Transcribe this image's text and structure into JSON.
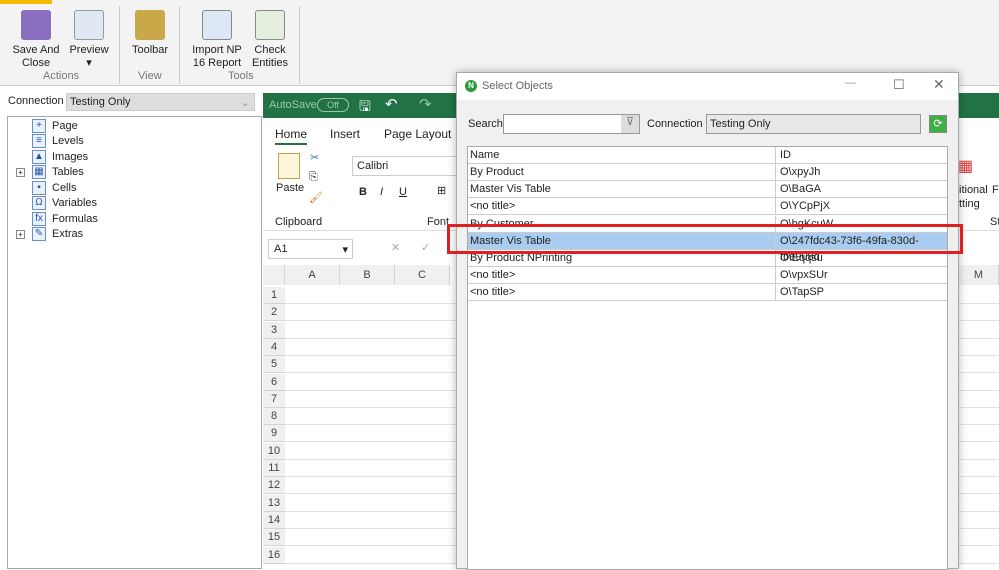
{
  "ribbon": {
    "buttons": [
      {
        "label": "Save And\nClose",
        "icon": "save-close-icon"
      },
      {
        "label": "Preview",
        "icon": "preview-icon"
      },
      {
        "label": "Toolbar",
        "icon": "tools-icon"
      },
      {
        "label": "Import NP\n16 Report",
        "icon": "import-icon"
      },
      {
        "label": "Check\nEntities",
        "icon": "check-entities-icon"
      }
    ],
    "groups": [
      "Actions",
      "View",
      "Tools"
    ]
  },
  "connection": {
    "label": "Connection",
    "value": "Testing Only"
  },
  "tree": [
    {
      "label": "Page",
      "expand": false,
      "glyph": "+"
    },
    {
      "label": "Levels",
      "expand": false,
      "glyph": "≡"
    },
    {
      "label": "Images",
      "expand": false,
      "glyph": "▲"
    },
    {
      "label": "Tables",
      "expand": true,
      "glyph": "▦"
    },
    {
      "label": "Cells",
      "expand": false,
      "glyph": "▪"
    },
    {
      "label": "Variables",
      "expand": false,
      "glyph": "Ω"
    },
    {
      "label": "Formulas",
      "expand": false,
      "glyph": "fx"
    },
    {
      "label": "Extras",
      "expand": true,
      "glyph": "✎"
    }
  ],
  "excel": {
    "autosave": "AutoSave",
    "autosave_state": "Off",
    "tabs": [
      "Home",
      "Insert",
      "Page Layout"
    ],
    "paste": "Paste",
    "font": "Calibri",
    "clipboard": "Clipboard",
    "font_group": "Font",
    "namebox": "A1",
    "columns": [
      "A",
      "B",
      "C"
    ],
    "rows": [
      "1",
      "2",
      "3",
      "4",
      "5",
      "6",
      "7",
      "8",
      "9",
      "10",
      "11",
      "12",
      "13",
      "14",
      "15",
      "16"
    ],
    "right_partial": {
      "cond1": "itional",
      "cond2": "tting",
      "f": "F",
      "st": "St",
      "col_m": "M"
    },
    "accent": "#217346"
  },
  "dialog": {
    "title": "Select Objects",
    "search_label": "Search",
    "search_value": "",
    "connection_label": "Connection",
    "connection_value": "Testing Only",
    "columns": [
      "Name",
      "ID"
    ],
    "rows": [
      {
        "name": "By Product",
        "id": "O\\xpyJh"
      },
      {
        "name": "Master Vis Table",
        "id": "O\\BaGA"
      },
      {
        "name": "<no title>",
        "id": "O\\YCpPjX"
      },
      {
        "name": "By Customer",
        "id": "O\\bgKcuW"
      },
      {
        "name": "Master Vis Table",
        "id": "O\\247fdc43-73f6-49fa-830d-fbe908d",
        "selected": true
      },
      {
        "name": "By Product NPrinting",
        "id": "O\\Eqqsu"
      },
      {
        "name": "<no title>",
        "id": "O\\vpxSUr"
      },
      {
        "name": "<no title>",
        "id": "O\\TapSP"
      }
    ],
    "highlight_color": "#e02020",
    "selection_color": "#a9cdf0"
  }
}
